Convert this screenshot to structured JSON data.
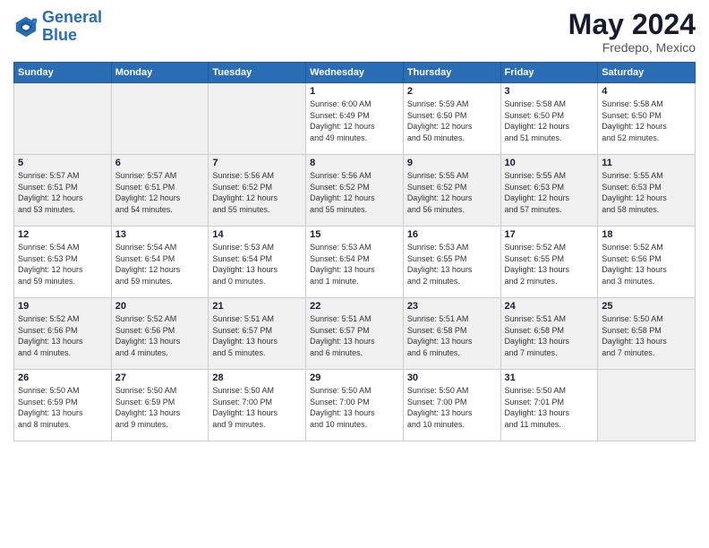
{
  "header": {
    "logo_line1": "General",
    "logo_line2": "Blue",
    "month": "May 2024",
    "location": "Fredepo, Mexico"
  },
  "weekdays": [
    "Sunday",
    "Monday",
    "Tuesday",
    "Wednesday",
    "Thursday",
    "Friday",
    "Saturday"
  ],
  "weeks": [
    [
      {
        "day": "",
        "info": ""
      },
      {
        "day": "",
        "info": ""
      },
      {
        "day": "",
        "info": ""
      },
      {
        "day": "1",
        "info": "Sunrise: 6:00 AM\nSunset: 6:49 PM\nDaylight: 12 hours\nand 49 minutes."
      },
      {
        "day": "2",
        "info": "Sunrise: 5:59 AM\nSunset: 6:50 PM\nDaylight: 12 hours\nand 50 minutes."
      },
      {
        "day": "3",
        "info": "Sunrise: 5:58 AM\nSunset: 6:50 PM\nDaylight: 12 hours\nand 51 minutes."
      },
      {
        "day": "4",
        "info": "Sunrise: 5:58 AM\nSunset: 6:50 PM\nDaylight: 12 hours\nand 52 minutes."
      }
    ],
    [
      {
        "day": "5",
        "info": "Sunrise: 5:57 AM\nSunset: 6:51 PM\nDaylight: 12 hours\nand 53 minutes."
      },
      {
        "day": "6",
        "info": "Sunrise: 5:57 AM\nSunset: 6:51 PM\nDaylight: 12 hours\nand 54 minutes."
      },
      {
        "day": "7",
        "info": "Sunrise: 5:56 AM\nSunset: 6:52 PM\nDaylight: 12 hours\nand 55 minutes."
      },
      {
        "day": "8",
        "info": "Sunrise: 5:56 AM\nSunset: 6:52 PM\nDaylight: 12 hours\nand 55 minutes."
      },
      {
        "day": "9",
        "info": "Sunrise: 5:55 AM\nSunset: 6:52 PM\nDaylight: 12 hours\nand 56 minutes."
      },
      {
        "day": "10",
        "info": "Sunrise: 5:55 AM\nSunset: 6:53 PM\nDaylight: 12 hours\nand 57 minutes."
      },
      {
        "day": "11",
        "info": "Sunrise: 5:55 AM\nSunset: 6:53 PM\nDaylight: 12 hours\nand 58 minutes."
      }
    ],
    [
      {
        "day": "12",
        "info": "Sunrise: 5:54 AM\nSunset: 6:53 PM\nDaylight: 12 hours\nand 59 minutes."
      },
      {
        "day": "13",
        "info": "Sunrise: 5:54 AM\nSunset: 6:54 PM\nDaylight: 12 hours\nand 59 minutes."
      },
      {
        "day": "14",
        "info": "Sunrise: 5:53 AM\nSunset: 6:54 PM\nDaylight: 13 hours\nand 0 minutes."
      },
      {
        "day": "15",
        "info": "Sunrise: 5:53 AM\nSunset: 6:54 PM\nDaylight: 13 hours\nand 1 minute."
      },
      {
        "day": "16",
        "info": "Sunrise: 5:53 AM\nSunset: 6:55 PM\nDaylight: 13 hours\nand 2 minutes."
      },
      {
        "day": "17",
        "info": "Sunrise: 5:52 AM\nSunset: 6:55 PM\nDaylight: 13 hours\nand 2 minutes."
      },
      {
        "day": "18",
        "info": "Sunrise: 5:52 AM\nSunset: 6:56 PM\nDaylight: 13 hours\nand 3 minutes."
      }
    ],
    [
      {
        "day": "19",
        "info": "Sunrise: 5:52 AM\nSunset: 6:56 PM\nDaylight: 13 hours\nand 4 minutes."
      },
      {
        "day": "20",
        "info": "Sunrise: 5:52 AM\nSunset: 6:56 PM\nDaylight: 13 hours\nand 4 minutes."
      },
      {
        "day": "21",
        "info": "Sunrise: 5:51 AM\nSunset: 6:57 PM\nDaylight: 13 hours\nand 5 minutes."
      },
      {
        "day": "22",
        "info": "Sunrise: 5:51 AM\nSunset: 6:57 PM\nDaylight: 13 hours\nand 6 minutes."
      },
      {
        "day": "23",
        "info": "Sunrise: 5:51 AM\nSunset: 6:58 PM\nDaylight: 13 hours\nand 6 minutes."
      },
      {
        "day": "24",
        "info": "Sunrise: 5:51 AM\nSunset: 6:58 PM\nDaylight: 13 hours\nand 7 minutes."
      },
      {
        "day": "25",
        "info": "Sunrise: 5:50 AM\nSunset: 6:58 PM\nDaylight: 13 hours\nand 7 minutes."
      }
    ],
    [
      {
        "day": "26",
        "info": "Sunrise: 5:50 AM\nSunset: 6:59 PM\nDaylight: 13 hours\nand 8 minutes."
      },
      {
        "day": "27",
        "info": "Sunrise: 5:50 AM\nSunset: 6:59 PM\nDaylight: 13 hours\nand 9 minutes."
      },
      {
        "day": "28",
        "info": "Sunrise: 5:50 AM\nSunset: 7:00 PM\nDaylight: 13 hours\nand 9 minutes."
      },
      {
        "day": "29",
        "info": "Sunrise: 5:50 AM\nSunset: 7:00 PM\nDaylight: 13 hours\nand 10 minutes."
      },
      {
        "day": "30",
        "info": "Sunrise: 5:50 AM\nSunset: 7:00 PM\nDaylight: 13 hours\nand 10 minutes."
      },
      {
        "day": "31",
        "info": "Sunrise: 5:50 AM\nSunset: 7:01 PM\nDaylight: 13 hours\nand 11 minutes."
      },
      {
        "day": "",
        "info": ""
      }
    ]
  ]
}
